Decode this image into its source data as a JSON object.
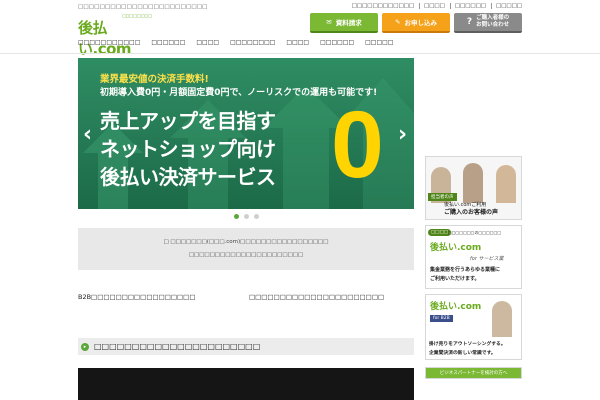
{
  "header": {
    "tagline": "□□□□□□□□□□□□□□□□□□□□□□□□",
    "logo_text": "後払い.com",
    "logo_sub": "□□□□□□□□",
    "top_links": [
      "□□□□□□□□□□□□",
      "□□□□",
      "□□□□□□",
      "□□□□□"
    ],
    "btn_doc": "資料請求",
    "btn_apply": "お申し込み",
    "btn_contact_l1": "ご購入者様の",
    "btn_contact_l2": "お問い合わせ"
  },
  "nav": {
    "items": [
      "□□□□□□□□□□□",
      "□□□□□□",
      "□□□□",
      "□□□□□□□□",
      "□□□□",
      "□□□□□□",
      "□□□□□"
    ]
  },
  "hero": {
    "sub1": "業界最安値の決済手数料!",
    "sub2": "初期導入費0円・月額固定費0円で、ノーリスクでの運用も可能です!",
    "main1": "売上アップを目指す",
    "main2": "ネットショップ向け",
    "main3": "後払い決済サービス",
    "zero": "0",
    "yen": "円",
    "prev": "‹",
    "next": "›"
  },
  "notice": {
    "line1": "□ □□□□□□□(□□□.com)□□□□□□□□□□□□□□□□□",
    "line2": "□□□□□□□□□□□□□□□□□□□□□□"
  },
  "columns": {
    "left": "B2B□□□□□□□□□□□□□□□□□",
    "right": "□□□□□□□□□□□□□□□□□□□□□□"
  },
  "section": {
    "icon": "▸",
    "title": "□□□□□□□□□□□□□□□□□□□□□□"
  },
  "sidebar": {
    "banner1_tag": "担当者の声",
    "banner1_l1": "後払い.comご利用",
    "banner1_l2": "ご購入のお客様の声",
    "banner2_tag": "□□□□",
    "banner2_top": "□□□□□□□の□□□□□□",
    "banner2_logo": "後払い.com",
    "banner2_for": "for サービス業",
    "banner2_l1": "集金業務を行うあらゆる業種に",
    "banner2_l2": "ご利用いただけます。",
    "banner3_logo": "後払い.com",
    "banner3_for": "for B2B",
    "banner3_l1": "掛け売りをアウトソーシングする。",
    "banner3_l2": "企業間決済の新しい常識です。",
    "banner4": "ビジネスパートナーを検討の方へ"
  },
  "colors": {
    "brand_green": "#6aab1e",
    "hero_green": "#2f8d63",
    "accent_yellow": "#ffd400",
    "apply_orange": "#f5a21a"
  }
}
